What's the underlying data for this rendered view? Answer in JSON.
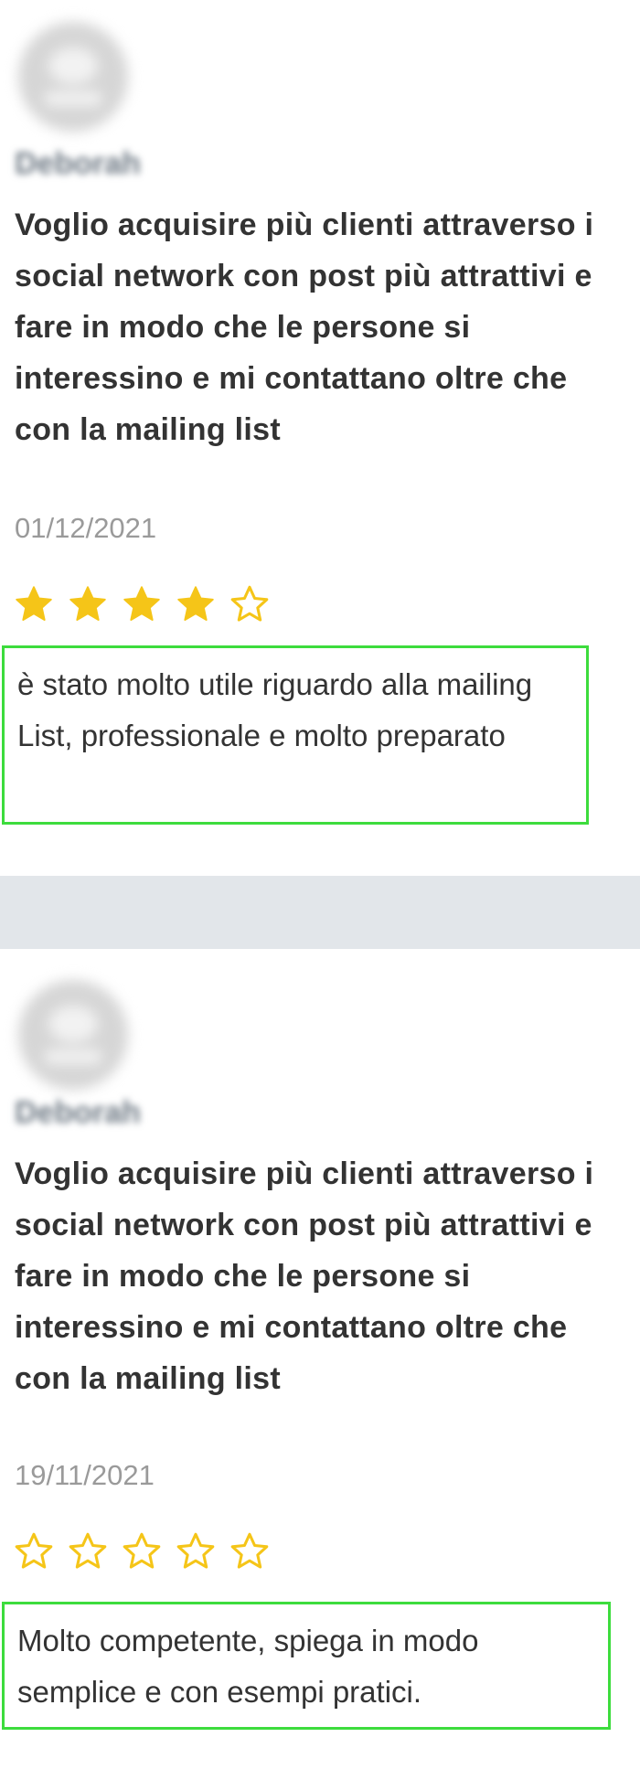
{
  "reviews": [
    {
      "author": "Deborah",
      "title": "Voglio acquisire più clienti attraverso i social network con post più attrattivi e fare in modo che le persone si interessino e mi contattano oltre che con la mailing list",
      "date": "01/12/2021",
      "rating": 4,
      "rating_max": 5,
      "comment": "è stato molto utile riguardo alla mailing List, professionale e molto preparato"
    },
    {
      "author": "Deborah",
      "title": "Voglio acquisire più clienti attraverso i social network con post più attrattivi e fare in modo che le persone si interessino e mi contattano oltre che con la mailing list",
      "date": "19/11/2021",
      "rating": 0,
      "rating_max": 5,
      "comment": "Molto competente, spiega in modo semplice e con esempi pratici."
    }
  ],
  "colors": {
    "star": "#f5c518",
    "highlight_border": "#3ddc3d",
    "separator": "#e2e6ea",
    "date": "#9a9a9a",
    "text": "#333333"
  }
}
